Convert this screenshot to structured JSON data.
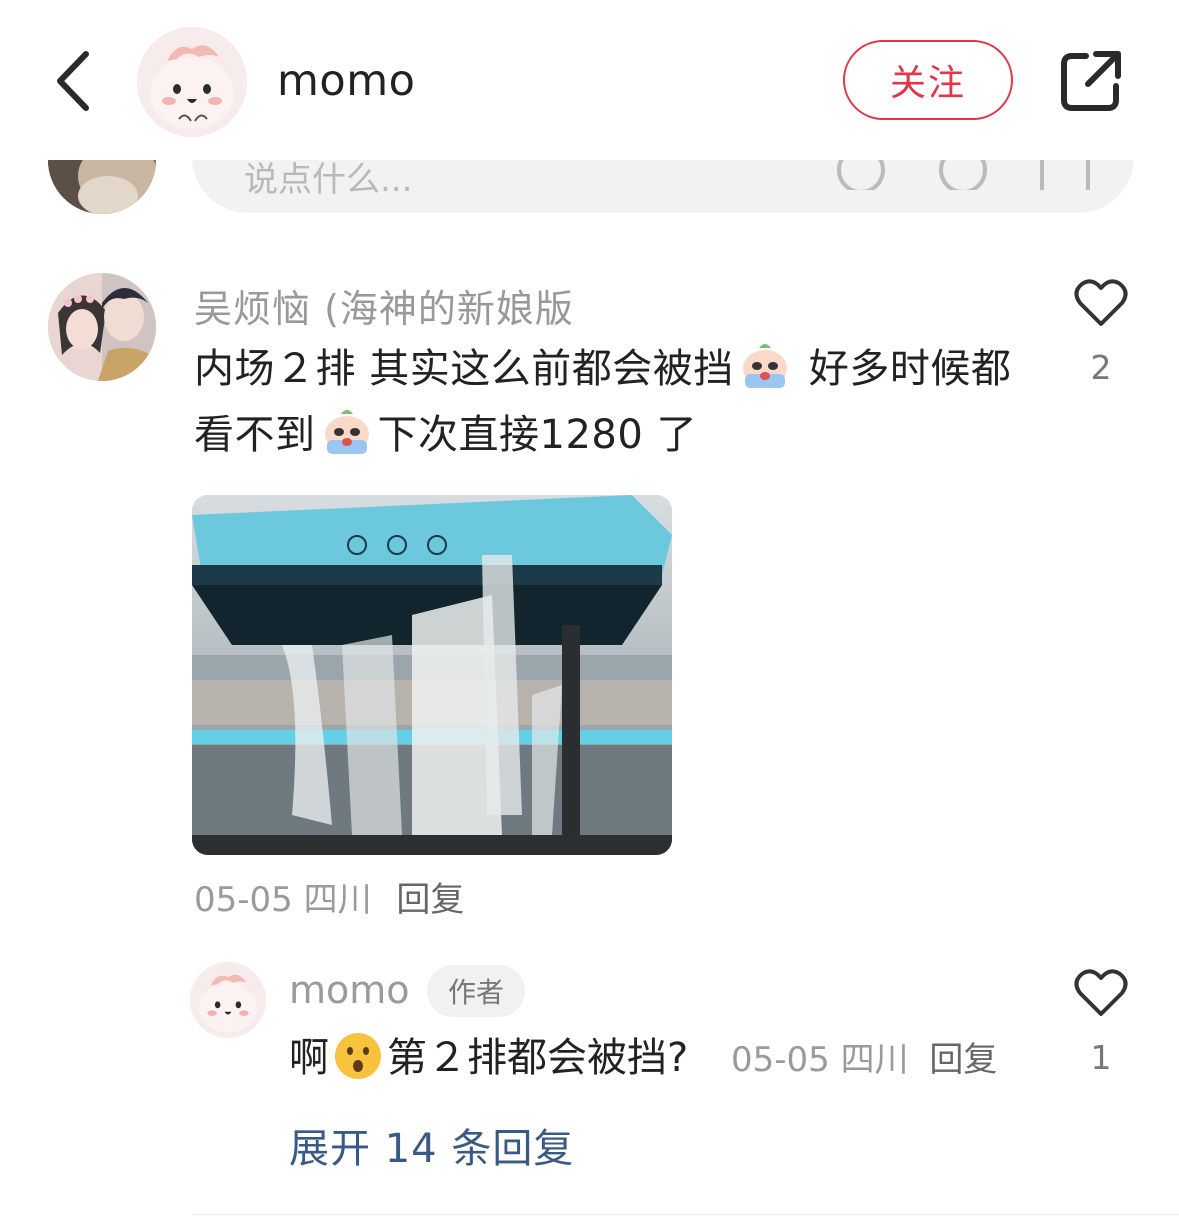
{
  "header": {
    "back_icon": "chevron-left-icon",
    "user_name": "momo",
    "follow_label": "关注",
    "share_icon": "share-icon",
    "accent_color": "#e0364a"
  },
  "compose": {
    "placeholder": "说点什么..."
  },
  "comment": {
    "author": "吴烦恼 (海神的新娘版",
    "text_part1": "内场２排 其实这么前都会被挡",
    "text_part2": " 好多时候都看不到",
    "text_part3": "下次直接1280 了",
    "photo_caption": "concert-stage-photo",
    "date": "05-05",
    "location": "四川",
    "reply_label": "回复",
    "like_count": "2"
  },
  "reply": {
    "author": "momo",
    "badge": "作者",
    "text_part1": "啊",
    "text_part2": "第２排都会被挡?",
    "date": "05-05",
    "location": "四川",
    "reply_label": "回复",
    "like_count": "1"
  },
  "expand_label": "展开 14 条回复"
}
